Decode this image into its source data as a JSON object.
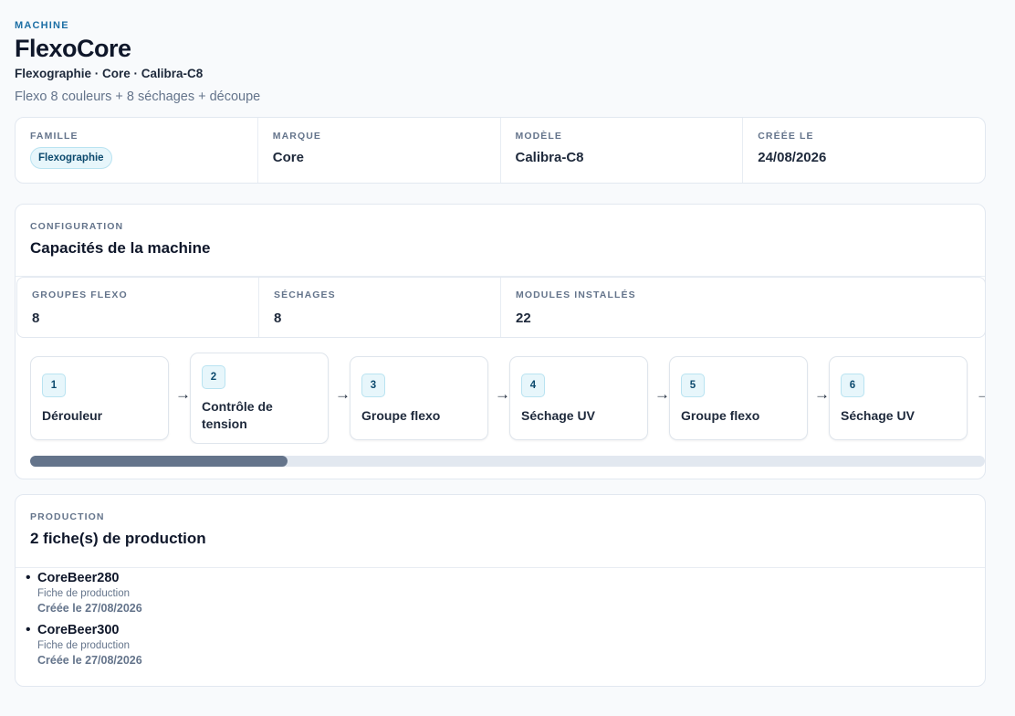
{
  "header": {
    "eyebrow": "MACHINE",
    "title": "FlexoCore",
    "subtitle": "Flexographie · Core · Calibra-C8",
    "description": "Flexo 8 couleurs + 8 séchages + découpe"
  },
  "info": {
    "family_label": "FAMILLE",
    "family_value": "Flexographie",
    "brand_label": "MARQUE",
    "brand_value": "Core",
    "model_label": "MODÈLE",
    "model_value": "Calibra-C8",
    "created_label": "CRÉÉE LE",
    "created_value": "24/08/2026"
  },
  "configuration": {
    "eyebrow": "CONFIGURATION",
    "title": "Capacités de la machine",
    "stats": [
      {
        "label": "GROUPES FLEXO",
        "value": "8"
      },
      {
        "label": "SÉCHAGES",
        "value": "8"
      },
      {
        "label": "MODULES INSTALLÉS",
        "value": "22"
      }
    ],
    "steps": [
      {
        "num": "1",
        "label": "Dérouleur"
      },
      {
        "num": "2",
        "label": "Contrôle de tension"
      },
      {
        "num": "3",
        "label": "Groupe flexo"
      },
      {
        "num": "4",
        "label": "Séchage UV"
      },
      {
        "num": "5",
        "label": "Groupe flexo"
      },
      {
        "num": "6",
        "label": "Séchage UV"
      }
    ],
    "arrow_glyph": "→",
    "scroll_fraction": 0.27
  },
  "production": {
    "eyebrow": "PRODUCTION",
    "title": "2 fiche(s) de production",
    "items": [
      {
        "name": "CoreBeer280",
        "type": "Fiche de production",
        "date": "Créée le 27/08/2026"
      },
      {
        "name": "CoreBeer300",
        "type": "Fiche de production",
        "date": "Créée le 27/08/2026"
      }
    ]
  },
  "colors": {
    "accent": "#1d6fa5",
    "badge_bg": "#e7f6fb",
    "scroll_thumb": "#64748b"
  }
}
